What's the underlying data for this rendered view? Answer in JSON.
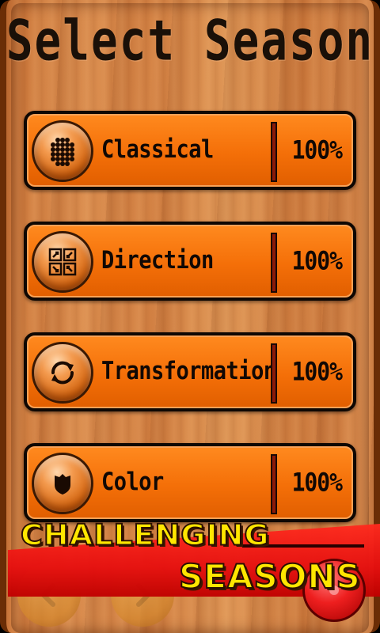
{
  "title": "Select Season",
  "seasons": [
    {
      "name": "Classical",
      "progress": "100%",
      "icon": "dots-grid-icon"
    },
    {
      "name": "Direction",
      "progress": "100%",
      "icon": "arrows-grid-icon"
    },
    {
      "name": "Transformation",
      "progress": "100%",
      "icon": "cycle-arrows-icon"
    },
    {
      "name": "Color",
      "progress": "100%",
      "icon": "shield-icon"
    }
  ],
  "banner": {
    "line1": "CHALLENGING",
    "line2": "SEASONS"
  },
  "nav": {
    "prev_icon": "chevron-left-icon",
    "next_icon": "chevron-right-icon",
    "home_icon": "home-button-icon"
  },
  "colors": {
    "row_orange": "#f46f08",
    "banner_red": "#e60f0f",
    "banner_text": "#ffe600"
  }
}
